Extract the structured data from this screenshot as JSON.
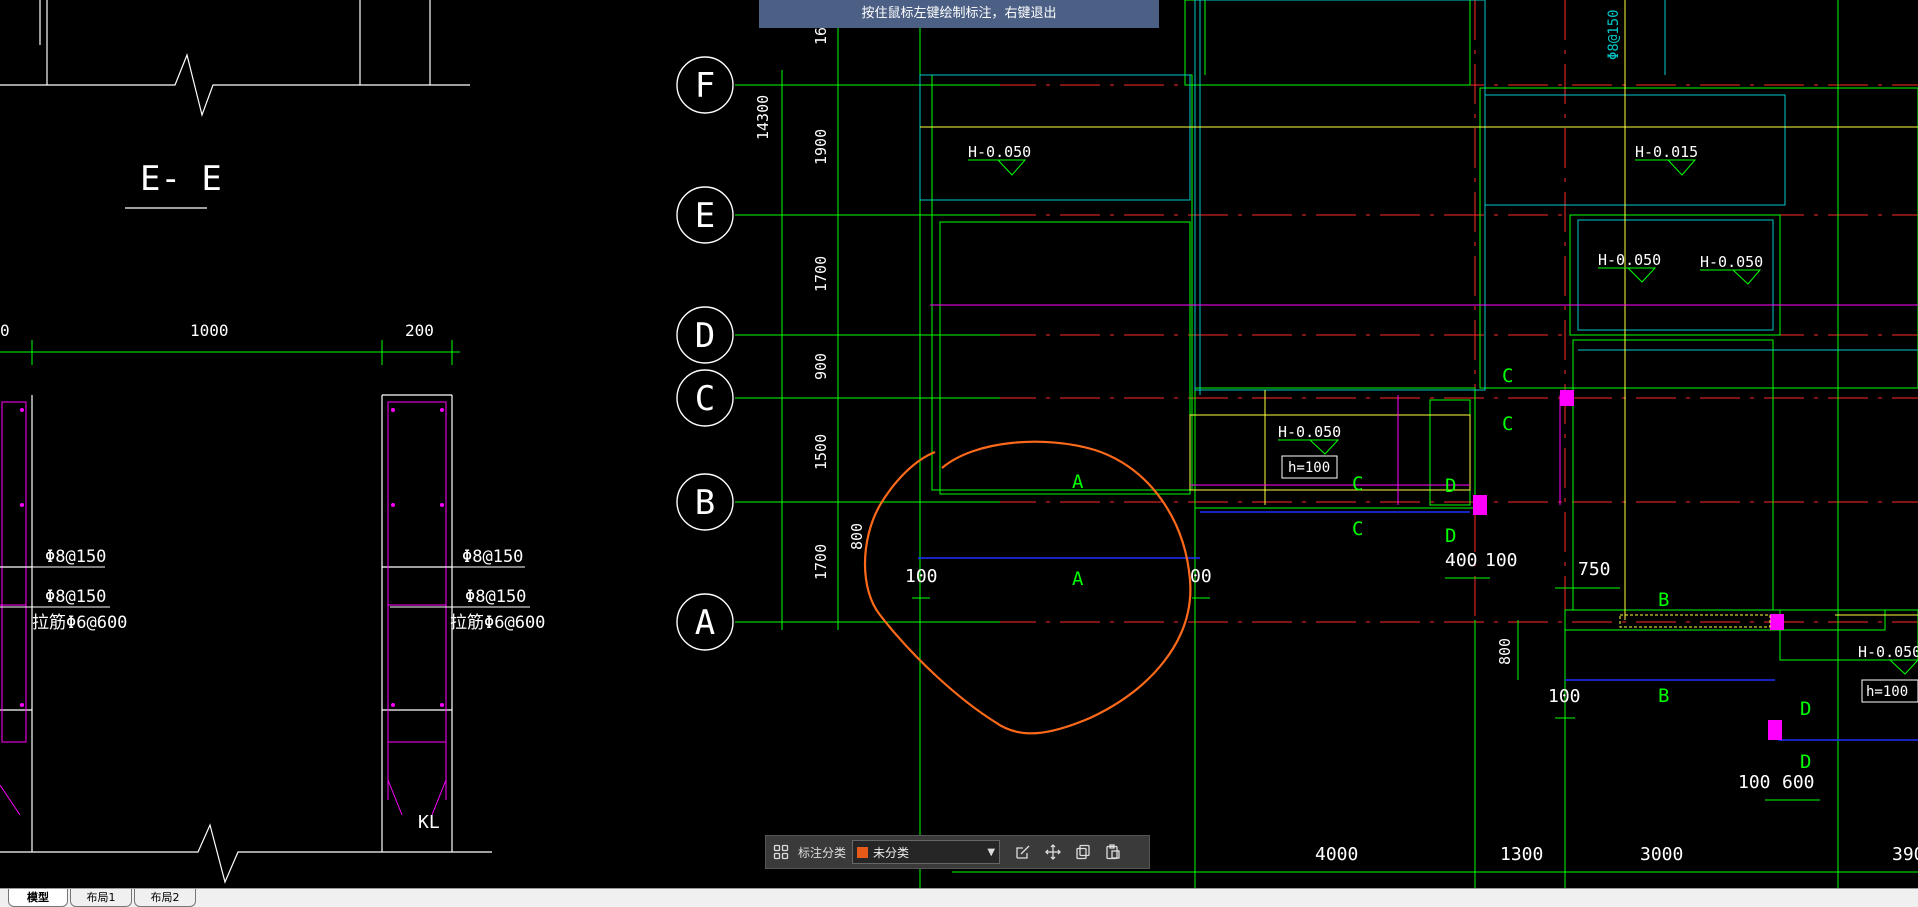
{
  "hint": {
    "text": "按住鼠标左键绘制标注，右键退出"
  },
  "drawing": {
    "section_title": "E- E",
    "left_dims": [
      "0",
      "1000",
      "200"
    ],
    "rebar_left": [
      "Φ8@150",
      "Φ8@150",
      "拉筋Φ6@600"
    ],
    "rebar_right": [
      "Φ8@150",
      "Φ8@150",
      "拉筋Φ6@600"
    ],
    "kl_label": "KL",
    "axes": {
      "F": "F",
      "E": "E",
      "D": "D",
      "C": "C",
      "B": "B",
      "A": "A"
    },
    "axis_dims": {
      "d14300": "14300",
      "d1900": "1900",
      "d1700a": "1700",
      "d900": "900",
      "d1500": "1500",
      "d1700b": "1700",
      "d16": "16"
    },
    "elevations": {
      "h1": "H-0.050",
      "h2": "H-0.015",
      "h3": "H-0.050",
      "h4": "H-0.050",
      "h5": "H-0.050",
      "h6": "H-0.050"
    },
    "h100": {
      "a": "h=100",
      "b": "h=100"
    },
    "section_marks": {
      "a1": "A",
      "a2": "A",
      "b1": "B",
      "b2": "B",
      "c1": "C",
      "c2": "C",
      "c3": "C",
      "c4": "C",
      "d1": "D",
      "d2": "D",
      "d3": "D",
      "d4": "D"
    },
    "dims": {
      "v800a": "800",
      "v800b": "800",
      "d100a": "100",
      "d100b": "00",
      "d400": "400",
      "d100c": "100",
      "d750": "750",
      "d100d": "100",
      "d100e": "100",
      "d600": "600"
    },
    "bottom_dims": {
      "d4000": "4000",
      "d1300": "1300",
      "d3000": "3000",
      "d390": "390"
    },
    "v_label": "Φ8@150"
  },
  "annotation_toolbar": {
    "grid_icon": "grid-icon",
    "category_label": "标注分类",
    "category_value": "未分类",
    "category_color": "#e85a1a",
    "tools": [
      "edit-icon",
      "move-icon",
      "copy-icon",
      "paste-icon"
    ]
  },
  "tabs": [
    {
      "label": "模型",
      "active": true
    },
    {
      "label": "布局1",
      "active": false
    },
    {
      "label": "布局2",
      "active": false
    }
  ],
  "colors": {
    "grid": "#00ff00",
    "red_axis": "#ff2a2a",
    "magenta": "#ff00ff",
    "cyan": "#00c8c8",
    "yellow": "#ffff40",
    "blue": "#2030ff",
    "annotation": "#ff6a1a"
  }
}
